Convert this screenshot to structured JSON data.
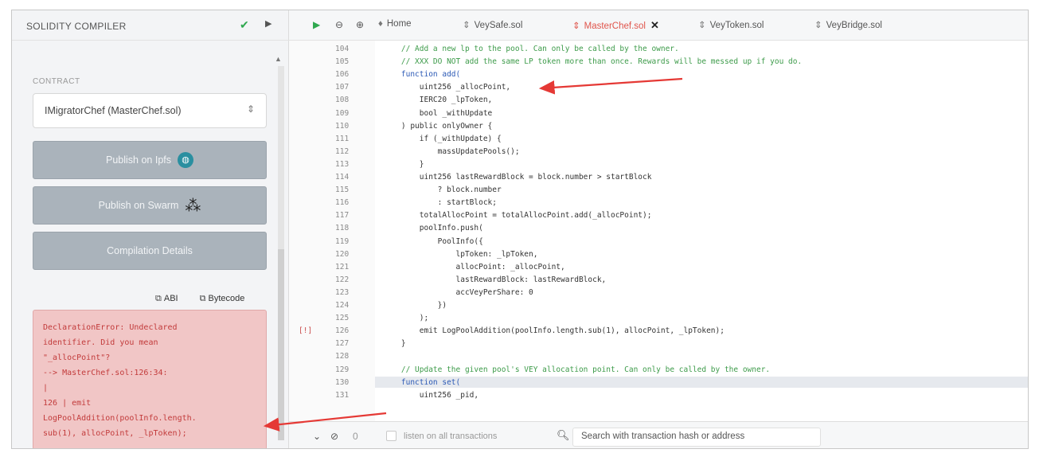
{
  "left": {
    "title": "SOLIDITY COMPILER",
    "contract_label": "CONTRACT",
    "contract_value": "IMigratorChef (MasterChef.sol)",
    "publish_ipfs": "Publish on Ipfs",
    "publish_swarm": "Publish on Swarm",
    "compilation_details": "Compilation Details",
    "abi": "ABI",
    "bytecode": "Bytecode",
    "error_lines": [
      "DeclarationError: Undeclared",
      "identifier. Did you mean",
      "\"_allocPoint\"?",
      "--> MasterChef.sol:126:34:",
      "|",
      "126 | emit",
      "LogPoolAddition(poolInfo.length.",
      "sub(1), allocPoint, _lpToken);"
    ]
  },
  "editor": {
    "tabs": [
      {
        "label": "Home"
      },
      {
        "label": "VeySafe.sol"
      },
      {
        "label": "MasterChef.sol"
      },
      {
        "label": "VeyToken.sol"
      },
      {
        "label": "VeyBridge.sol"
      }
    ],
    "line_numbers": [
      "104",
      "105",
      "106",
      "107",
      "108",
      "109",
      "110",
      "111",
      "112",
      "113",
      "114",
      "115",
      "116",
      "117",
      "118",
      "119",
      "120",
      "121",
      "122",
      "123",
      "124",
      "125",
      "126",
      "127",
      "128",
      "129",
      "130",
      "131"
    ],
    "gutter_marker": "[!]",
    "code": [
      {
        "t": "    // Add a new lp to the pool. Can only be called by the owner.",
        "c": "cmt"
      },
      {
        "t": "    // XXX DO NOT add the same LP token more than once. Rewards will be messed up if you do.",
        "c": "cmt"
      },
      {
        "t": "    function add(",
        "c": "kw"
      },
      {
        "t": "        uint256 _allocPoint,",
        "c": ""
      },
      {
        "t": "        IERC20 _lpToken,",
        "c": ""
      },
      {
        "t": "        bool _withUpdate",
        "c": ""
      },
      {
        "t": "    ) public onlyOwner {",
        "c": ""
      },
      {
        "t": "        if (_withUpdate) {",
        "c": ""
      },
      {
        "t": "            massUpdatePools();",
        "c": ""
      },
      {
        "t": "        }",
        "c": ""
      },
      {
        "t": "        uint256 lastRewardBlock = block.number > startBlock",
        "c": ""
      },
      {
        "t": "            ? block.number",
        "c": ""
      },
      {
        "t": "            : startBlock;",
        "c": ""
      },
      {
        "t": "        totalAllocPoint = totalAllocPoint.add(_allocPoint);",
        "c": ""
      },
      {
        "t": "        poolInfo.push(",
        "c": ""
      },
      {
        "t": "            PoolInfo({",
        "c": ""
      },
      {
        "t": "                lpToken: _lpToken,",
        "c": ""
      },
      {
        "t": "                allocPoint: _allocPoint,",
        "c": ""
      },
      {
        "t": "                lastRewardBlock: lastRewardBlock,",
        "c": ""
      },
      {
        "t": "                accVeyPerShare: 0",
        "c": ""
      },
      {
        "t": "            })",
        "c": ""
      },
      {
        "t": "        );",
        "c": ""
      },
      {
        "t": "        emit LogPoolAddition(poolInfo.length.sub(1), allocPoint, _lpToken);",
        "c": ""
      },
      {
        "t": "    }",
        "c": ""
      },
      {
        "t": "",
        "c": ""
      },
      {
        "t": "    // Update the given pool's VEY allocation point. Can only be called by the owner.",
        "c": "cmt"
      },
      {
        "t": "    function set(",
        "c": "kw"
      },
      {
        "t": "        uint256 _pid,",
        "c": ""
      }
    ]
  },
  "terminal": {
    "listen_label": "listen on all transactions",
    "search_placeholder": "Search with transaction hash or address"
  },
  "colors": {
    "annotation_arrow": "#e53935",
    "error_bg": "#f1c6c6",
    "error_text": "#c23b3b",
    "active_tab": "#e0554c",
    "button_bg": "#aab3bb"
  }
}
